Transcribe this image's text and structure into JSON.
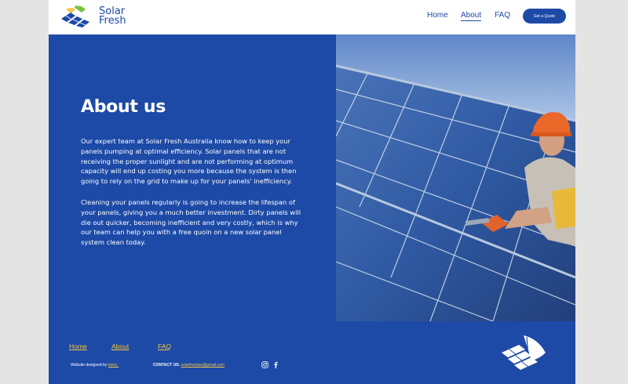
{
  "brand": {
    "name_line1": "Solar",
    "name_line2": "Fresh"
  },
  "nav": {
    "home": "Home",
    "about": "About",
    "faq": "FAQ",
    "cta": "Get a Quote"
  },
  "about": {
    "title": "About us",
    "paragraph1": "Our expert team at Solar Fresh Australia know how to keep your panels pumping at optimal efficiency. Solar panels that are not receiving the proper sunlight and are not performing at optimum capacity will end up costing you more because the system is then going to rely on the grid to make up for your panels' inefficiency.",
    "paragraph2": "Cleaning your panels regularly is going to increase the lifespan of your panels, giving you a much better investment. Dirty panels will die out quicker, becoming inefficient and very costly, which is why our team can help you with a free quoin on a new solar panel system clean today."
  },
  "footer": {
    "links": {
      "home": "Home",
      "about": "About",
      "faq": "FAQ"
    },
    "designed_prefix": "Website designed by",
    "designer": "beinc.",
    "contact_label": "CONTACT US:",
    "contact_email": "solarfreshau@gmail.com",
    "social_icons": [
      "instagram-icon",
      "facebook-icon"
    ]
  },
  "colors": {
    "brand_blue": "#1d4aa6",
    "accent_yellow": "#f2c744",
    "leaf_green": "#7cc142",
    "white": "#ffffff"
  }
}
